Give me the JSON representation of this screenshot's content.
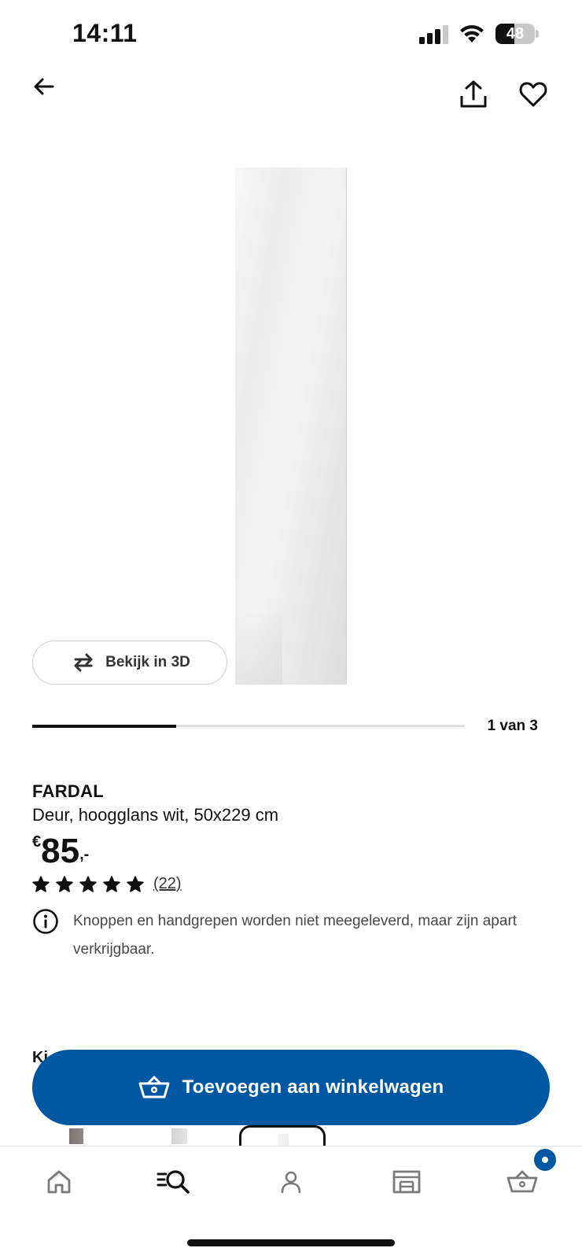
{
  "status_bar": {
    "time": "14:11",
    "battery_percent": 48,
    "battery_label": "48",
    "icons": [
      "signal-icon",
      "wifi-icon",
      "battery-icon"
    ]
  },
  "top_nav": {
    "icons": [
      "back-arrow-icon",
      "share-icon",
      "heart-icon"
    ]
  },
  "gallery": {
    "view_3d_label": "Bekijk in 3D",
    "counter": "1 van 3",
    "current_index": 1,
    "total": 3
  },
  "product": {
    "name": "FARDAL",
    "description": "Deur, hoogglans wit, 50x229 cm",
    "price": {
      "currency": "€",
      "value": "85",
      "suffix": ",-"
    },
    "rating": {
      "stars": 5,
      "max_stars": 5,
      "review_count": "(22)"
    },
    "info_note": "Knoppen en handgrepen worden niet meegeleverd, maar zijn apart verkrijgbaar."
  },
  "section_peek": "Ki",
  "actions": {
    "add_to_cart_label": "Toevoegen aan winkelwagen"
  },
  "bottom_nav": {
    "items": [
      "home-icon",
      "search-icon",
      "profile-icon",
      "store-icon",
      "cart-icon"
    ],
    "active": "search-icon"
  },
  "colors": {
    "brand_blue": "#0058a3",
    "text": "#111111",
    "muted_text": "#484848"
  }
}
